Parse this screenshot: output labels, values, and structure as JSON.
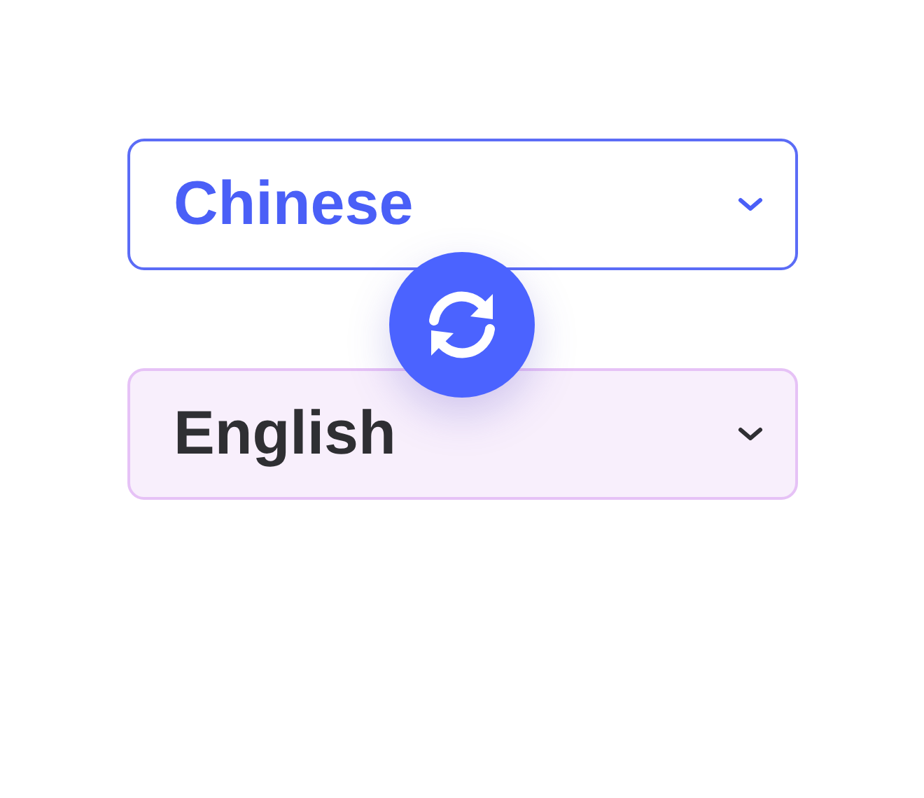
{
  "languages": [
    {
      "value": "Chinese",
      "focused": true
    },
    {
      "value": "English",
      "focused": false
    }
  ]
}
